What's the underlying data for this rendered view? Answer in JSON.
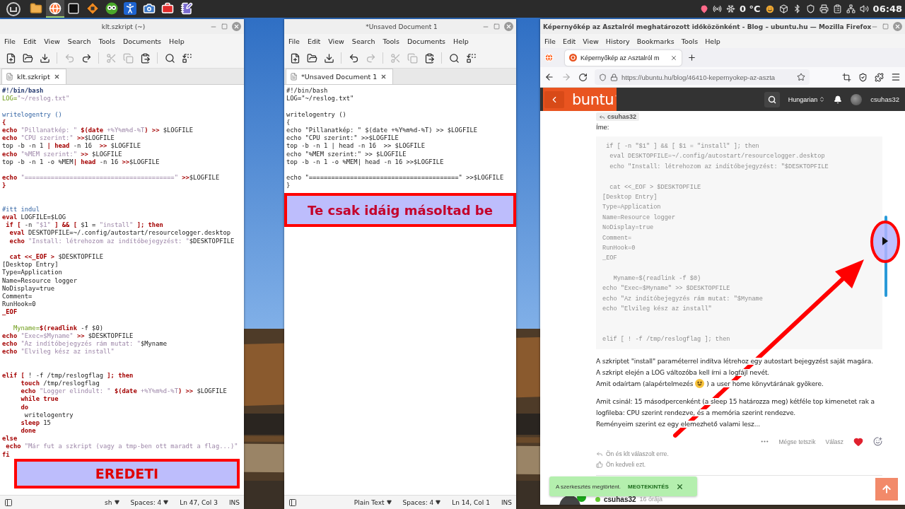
{
  "taskbar": {
    "launchers": [
      {
        "kind": "folder",
        "selected": false
      },
      {
        "kind": "browser",
        "selected": true
      },
      {
        "kind": "terminal",
        "selected": false
      },
      {
        "kind": "sign",
        "selected": false
      },
      {
        "kind": "owl",
        "selected": false
      },
      {
        "kind": "accessibility",
        "selected": false
      },
      {
        "kind": "camera",
        "selected": false
      },
      {
        "kind": "toolbox",
        "selected": false
      },
      {
        "kind": "notes",
        "selected": false
      }
    ],
    "temperature": "0 °C",
    "clock": "06:48"
  },
  "editors": [
    {
      "title": "klt.szkript (~)",
      "menus": [
        "File",
        "Edit",
        "View",
        "Search",
        "Tools",
        "Documents",
        "Help"
      ],
      "toolbar": [
        {
          "kind": "new",
          "disabled": false
        },
        {
          "kind": "open",
          "disabled": false
        },
        {
          "kind": "save",
          "disabled": false
        },
        {
          "kind": "undo",
          "disabled": true
        },
        {
          "kind": "redo",
          "disabled": false
        },
        {
          "kind": "cut",
          "disabled": true
        },
        {
          "kind": "copy",
          "disabled": true
        },
        {
          "kind": "paste",
          "disabled": false
        },
        {
          "kind": "find",
          "disabled": false
        },
        {
          "kind": "replace",
          "disabled": false
        }
      ],
      "tab": {
        "label": "klt.szkript"
      },
      "lines": [
        {
          "kind": "code",
          "segments": [
            {
              "text": "#!/bin/bash",
              "kind": "shebang"
            }
          ]
        },
        {
          "kind": "code",
          "segments": [
            {
              "text": "LOG=",
              "kind": "var"
            },
            {
              "text": "\"~/reslog.txt\"",
              "kind": "str"
            }
          ]
        },
        {
          "kind": "blank"
        },
        {
          "kind": "code",
          "segments": [
            {
              "text": "writelogentry ()",
              "kind": "fn"
            }
          ]
        },
        {
          "kind": "code",
          "segments": [
            {
              "text": "{",
              "kind": "kw"
            }
          ]
        },
        {
          "kind": "code",
          "segments": [
            {
              "text": "echo",
              "kind": "kw"
            },
            {
              "text": " \"Pillanatkép: \" ",
              "kind": "str"
            },
            {
              "text": "$(date",
              "kind": "kw"
            },
            {
              "text": " +%Y%m%d-%T",
              "kind": "str"
            },
            {
              "text": ") >>",
              "kind": "kw"
            },
            {
              "text": " $LOGFILE",
              "kind": "plain"
            }
          ]
        },
        {
          "kind": "code",
          "segments": [
            {
              "text": "echo",
              "kind": "kw"
            },
            {
              "text": " \"CPU szerint:\" ",
              "kind": "str"
            },
            {
              "text": ">>",
              "kind": "kw"
            },
            {
              "text": "$LOGFILE",
              "kind": "plain"
            }
          ]
        },
        {
          "kind": "code",
          "segments": [
            {
              "text": "top -b -n 1 ",
              "kind": "plain"
            },
            {
              "text": "| head",
              "kind": "kw"
            },
            {
              "text": " -n 16  ",
              "kind": "plain"
            },
            {
              "text": ">>",
              "kind": "kw"
            },
            {
              "text": " $LOGFILE",
              "kind": "plain"
            }
          ]
        },
        {
          "kind": "code",
          "segments": [
            {
              "text": "echo",
              "kind": "kw"
            },
            {
              "text": " \"%MEM szerint:\" ",
              "kind": "str"
            },
            {
              "text": ">>",
              "kind": "kw"
            },
            {
              "text": " $LOGFILE",
              "kind": "plain"
            }
          ]
        },
        {
          "kind": "code",
          "segments": [
            {
              "text": "top -b -n 1 -o %MEM",
              "kind": "plain"
            },
            {
              "text": "| head",
              "kind": "kw"
            },
            {
              "text": " -n 16 ",
              "kind": "plain"
            },
            {
              "text": ">>",
              "kind": "kw"
            },
            {
              "text": "$LOGFILE",
              "kind": "plain"
            }
          ]
        },
        {
          "kind": "blank"
        },
        {
          "kind": "code",
          "segments": [
            {
              "text": "echo",
              "kind": "kw"
            },
            {
              "text": " \"========================================\" ",
              "kind": "str"
            },
            {
              "text": ">>",
              "kind": "kw"
            },
            {
              "text": "$LOGFILE",
              "kind": "plain"
            }
          ]
        },
        {
          "kind": "code",
          "segments": [
            {
              "text": "}",
              "kind": "kw"
            }
          ]
        },
        {
          "kind": "blank"
        },
        {
          "kind": "blank"
        },
        {
          "kind": "code",
          "segments": [
            {
              "text": "#itt indul",
              "kind": "fn"
            }
          ]
        },
        {
          "kind": "code",
          "segments": [
            {
              "text": "eval",
              "kind": "kw"
            },
            {
              "text": " LOGFILE=$LOG",
              "kind": "plain"
            }
          ]
        },
        {
          "kind": "code",
          "segments": [
            {
              "text": " if [",
              "kind": "kw"
            },
            {
              "text": " -n ",
              "kind": "plain"
            },
            {
              "text": "\"$1\"",
              "kind": "str"
            },
            {
              "text": " ] && [",
              "kind": "kw"
            },
            {
              "text": " $1 = ",
              "kind": "plain"
            },
            {
              "text": "\"install\"",
              "kind": "str"
            },
            {
              "text": " ]; then",
              "kind": "kw"
            }
          ]
        },
        {
          "kind": "code",
          "segments": [
            {
              "text": "  eval",
              "kind": "kw"
            },
            {
              "text": " DESKTOPFILE=~/.config/autostart/resourcelogger.desktop",
              "kind": "plain"
            }
          ]
        },
        {
          "kind": "code",
          "segments": [
            {
              "text": "  echo",
              "kind": "kw"
            },
            {
              "text": " \"Install: létrehozom az indítóbejegyzést: \"",
              "kind": "str"
            },
            {
              "text": "$DESKTOPFILE",
              "kind": "plain"
            }
          ]
        },
        {
          "kind": "blank"
        },
        {
          "kind": "code",
          "segments": [
            {
              "text": "  cat <<_EOF >",
              "kind": "kw"
            },
            {
              "text": " $DESKTOPFILE",
              "kind": "plain"
            }
          ]
        },
        {
          "kind": "code",
          "segments": [
            {
              "text": "[Desktop Entry]",
              "kind": "plain"
            }
          ]
        },
        {
          "kind": "code",
          "segments": [
            {
              "text": "Type=Application",
              "kind": "plain"
            }
          ]
        },
        {
          "kind": "code",
          "segments": [
            {
              "text": "Name=Resource logger",
              "kind": "plain"
            }
          ]
        },
        {
          "kind": "code",
          "segments": [
            {
              "text": "NoDisplay=true",
              "kind": "plain"
            }
          ]
        },
        {
          "kind": "code",
          "segments": [
            {
              "text": "Comment=",
              "kind": "plain"
            }
          ]
        },
        {
          "kind": "code",
          "segments": [
            {
              "text": "RunHook=0",
              "kind": "plain"
            }
          ]
        },
        {
          "kind": "code",
          "segments": [
            {
              "text": "_EOF",
              "kind": "kw"
            }
          ]
        },
        {
          "kind": "blank"
        },
        {
          "kind": "code",
          "segments": [
            {
              "text": "   Myname=",
              "kind": "var"
            },
            {
              "text": "$(readlink",
              "kind": "kw"
            },
            {
              "text": " -f $0)",
              "kind": "plain"
            }
          ]
        },
        {
          "kind": "code",
          "segments": [
            {
              "text": "echo",
              "kind": "kw"
            },
            {
              "text": " \"Exec=$Myname\" ",
              "kind": "str"
            },
            {
              "text": ">>",
              "kind": "kw"
            },
            {
              "text": " $DESKTOPFILE",
              "kind": "plain"
            }
          ]
        },
        {
          "kind": "code",
          "segments": [
            {
              "text": "echo",
              "kind": "kw"
            },
            {
              "text": " \"Az indítóbejegyzés rám mutat: \"",
              "kind": "str"
            },
            {
              "text": "$Myname",
              "kind": "plain"
            }
          ]
        },
        {
          "kind": "code",
          "segments": [
            {
              "text": "echo",
              "kind": "kw"
            },
            {
              "text": " \"Elvileg kész az install\"",
              "kind": "str"
            }
          ]
        },
        {
          "kind": "blank"
        },
        {
          "kind": "blank"
        },
        {
          "kind": "code",
          "segments": [
            {
              "text": "elif [",
              "kind": "kw"
            },
            {
              "text": " ! -f /tmp/reslogflag ",
              "kind": "plain"
            },
            {
              "text": "]; then",
              "kind": "kw"
            }
          ]
        },
        {
          "kind": "code",
          "segments": [
            {
              "text": "     touch",
              "kind": "kw"
            },
            {
              "text": " /tmp/reslogflag",
              "kind": "plain"
            }
          ]
        },
        {
          "kind": "code",
          "segments": [
            {
              "text": "     echo",
              "kind": "kw"
            },
            {
              "text": " \"Logger elindult: \" ",
              "kind": "str"
            },
            {
              "text": "$(date",
              "kind": "kw"
            },
            {
              "text": " +%Y%m%d-%T",
              "kind": "str"
            },
            {
              "text": ") >>",
              "kind": "kw"
            },
            {
              "text": " $LOGFILE",
              "kind": "plain"
            }
          ]
        },
        {
          "kind": "code",
          "segments": [
            {
              "text": "     while true",
              "kind": "kw"
            }
          ]
        },
        {
          "kind": "code",
          "segments": [
            {
              "text": "     do",
              "kind": "kw"
            }
          ]
        },
        {
          "kind": "code",
          "segments": [
            {
              "text": "      writelogentry",
              "kind": "plain"
            }
          ]
        },
        {
          "kind": "code",
          "segments": [
            {
              "text": "     sleep",
              "kind": "kw"
            },
            {
              "text": " 15",
              "kind": "plain"
            }
          ]
        },
        {
          "kind": "code",
          "segments": [
            {
              "text": "     done",
              "kind": "kw"
            }
          ]
        },
        {
          "kind": "code",
          "segments": [
            {
              "text": "else",
              "kind": "kw"
            }
          ]
        },
        {
          "kind": "code",
          "segments": [
            {
              "text": " echo",
              "kind": "kw"
            },
            {
              "text": " \"Már fut a szkript (vagy a tmp-ben ott maradt a flag...)\"",
              "kind": "str"
            }
          ]
        },
        {
          "kind": "code",
          "segments": [
            {
              "text": "fi",
              "kind": "kw"
            }
          ]
        }
      ],
      "annotation": {
        "text": "EREDETI",
        "kind": "inset"
      },
      "status": {
        "language": "sh",
        "spaces": "Spaces: 4",
        "position": "Ln 47, Col 3",
        "mode": "INS"
      }
    },
    {
      "title": "*Unsaved Document 1",
      "menus": [
        "File",
        "Edit",
        "View",
        "Search",
        "Tools",
        "Documents",
        "Help"
      ],
      "toolbar": [
        {
          "kind": "new",
          "disabled": false
        },
        {
          "kind": "open",
          "disabled": false
        },
        {
          "kind": "save",
          "disabled": false
        },
        {
          "kind": "undo",
          "disabled": false
        },
        {
          "kind": "redo",
          "disabled": true
        },
        {
          "kind": "cut",
          "disabled": true
        },
        {
          "kind": "copy",
          "disabled": true
        },
        {
          "kind": "paste",
          "disabled": false
        },
        {
          "kind": "find",
          "disabled": false
        },
        {
          "kind": "replace",
          "disabled": false
        }
      ],
      "tab": {
        "label": "*Unsaved Document 1"
      },
      "lines": [
        {
          "kind": "code",
          "text": "#!/bin/bash"
        },
        {
          "kind": "code",
          "text": "LOG=\"~/reslog.txt\""
        },
        {
          "kind": "blank"
        },
        {
          "kind": "code",
          "text": "writelogentry ()"
        },
        {
          "kind": "code",
          "text": "{"
        },
        {
          "kind": "code",
          "text": "echo \"Pillanatkép: \" $(date +%Y%m%d-%T) >> $LOGFILE"
        },
        {
          "kind": "code",
          "text": "echo \"CPU szerint:\" >>$LOGFILE"
        },
        {
          "kind": "code",
          "text": "top -b -n 1 | head -n 16  >> $LOGFILE"
        },
        {
          "kind": "code",
          "text": "echo \"%MEM szerint:\" >> $LOGFILE"
        },
        {
          "kind": "code",
          "text": "top -b -n 1 -o %MEM| head -n 16 >>$LOGFILE"
        },
        {
          "kind": "blank"
        },
        {
          "kind": "code",
          "text": "echo \"========================================\" >>$LOGFILE"
        },
        {
          "kind": "code",
          "text": "}"
        }
      ],
      "annotation": {
        "text": "Te csak idáig másoltad be",
        "kind": "full"
      },
      "status": {
        "language": "Plain Text",
        "spaces": "Spaces: 4",
        "position": "Ln 14, Col 1",
        "mode": "INS"
      }
    }
  ],
  "browser": {
    "title": "Képernyőkép az Asztalról meghatározott időközönként - Blog – ubuntu.hu — Mozilla Firefox",
    "menus": [
      "File",
      "Edit",
      "View",
      "History",
      "Bookmarks",
      "Tools",
      "Help"
    ],
    "tab": {
      "label": "Képernyőkép az Asztalról m"
    },
    "url": "https://ubuntu.hu/blog/46410-kepernyokep-az-aszta",
    "page": {
      "logo": "buntu",
      "language": "Hungarian",
      "user": "csuhas32",
      "reply_to": "csuhas32",
      "intro": "Íme:",
      "code": [
        {
          "kind": "code",
          "text": " if [ -n \"$1\" ] && [ $1 = \"install\" ]; then"
        },
        {
          "kind": "code",
          "text": "  eval DESKTOPFILE=~/.config/autostart/resourcelogger.desktop"
        },
        {
          "kind": "code",
          "text": "  echo \"Install: létrehozom az indítóbejegyzést: \"$DESKTOPFILE"
        },
        {
          "kind": "blank"
        },
        {
          "kind": "code",
          "text": "  cat <<_EOF > $DESKTOPFILE"
        },
        {
          "kind": "code",
          "text": "[Desktop Entry]"
        },
        {
          "kind": "code",
          "text": "Type=Application"
        },
        {
          "kind": "code",
          "text": "Name=Resource logger"
        },
        {
          "kind": "code",
          "text": "NoDisplay=true"
        },
        {
          "kind": "code",
          "text": "Comment="
        },
        {
          "kind": "code",
          "text": "RunHook=0"
        },
        {
          "kind": "code",
          "text": "_EOF"
        },
        {
          "kind": "blank"
        },
        {
          "kind": "code",
          "text": "   Myname=$(readlink -f $0)"
        },
        {
          "kind": "code",
          "text": "echo \"Exec=$Myname\" >> $DESKTOPFILE"
        },
        {
          "kind": "code",
          "text": "echo \"Az indítóbejegyzés rám mutat: \"$Myname"
        },
        {
          "kind": "code",
          "text": "echo \"Elvileg kész az install\""
        },
        {
          "kind": "blank"
        },
        {
          "kind": "blank"
        },
        {
          "kind": "code",
          "text": "elif [ ! -f /tmp/reslogflag ]; then"
        }
      ],
      "paragraphs": [
        {
          "lines": [
            {
              "kind": "text",
              "text": "A szkriptet \"install\" paraméterrel indítva létrehoz egy autostart bejegyzést saját magára."
            },
            {
              "kind": "text",
              "text": "A szkript elején a LOG változóba kell írni a logfájl nevét."
            },
            {
              "kind": "emoji",
              "text": "Amit odaírtam (alapértelmezés",
              "after": ") a user home könyvtárának gyökere."
            }
          ]
        },
        {
          "lines": [
            {
              "kind": "text",
              "text": "Amit csinál: 15 másodpercenként (a sleep 15 határozza meg) kétféle top kimenetet rak a"
            },
            {
              "kind": "text",
              "text": "logfileba: CPU szerint rendezve, és a memória szerint rendezve."
            },
            {
              "kind": "text",
              "text": "Reményeim szerint ez egy elemezhető valami lesz..."
            }
          ]
        }
      ],
      "actions": {
        "unlike": "Mégse tetszik",
        "reply": "Válasz",
        "liked": true
      },
      "replies_info": "Ön és klt válaszolt erre.",
      "likes_info": "Ön kedveli ezt.",
      "toast": {
        "message": "A szerkesztés megtörtént.",
        "action": "MEGTEKINTÉS"
      },
      "next_post": {
        "author": "csuhas32",
        "time": "16 órája"
      }
    }
  }
}
